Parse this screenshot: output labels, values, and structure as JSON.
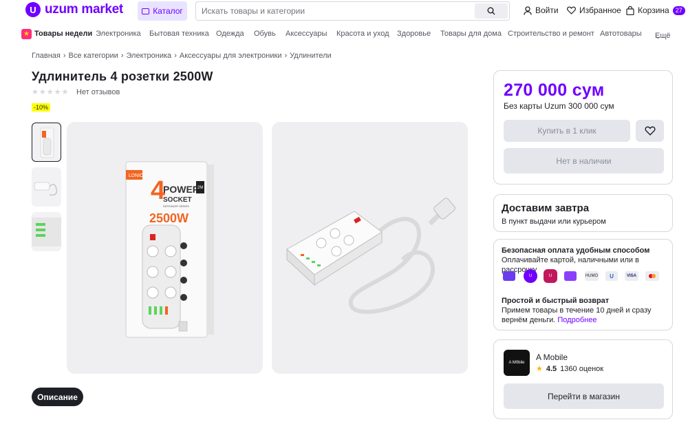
{
  "header": {
    "logo_text": "uzum market",
    "catalog_label": "Каталог",
    "search_placeholder": "Искать товары и категории",
    "login_label": "Войти",
    "favorites_label": "Избранное",
    "cart_label": "Корзина",
    "cart_count": "27",
    "brand_color": "#7000ff"
  },
  "nav": {
    "items": [
      "Товары недели",
      "Электроника",
      "Бытовая техника",
      "Одежда",
      "Обувь",
      "Аксессуары",
      "Красота и уход",
      "Здоровье",
      "Товары для дома",
      "Строительство и ремонт",
      "Автотовары",
      "Ещё"
    ]
  },
  "breadcrumbs": [
    "Главная",
    "Все категории",
    "Электроника",
    "Аксессуары для электроники",
    "Удлинители"
  ],
  "product": {
    "title": "Удлинитель 4 розетки 2500W",
    "rating_count": 0,
    "rating_text": "Нет отзывов",
    "discount_badge": "-10%",
    "box_brand": "LDNIO",
    "box_line1": "4",
    "box_line2": "POWER",
    "box_line3": "SOCKET",
    "box_watt": "2500W",
    "box_series": "DEFENDER SERIES",
    "box_cable": "2M",
    "description_tab": "Описание"
  },
  "buy_box": {
    "price": "270 000 сум",
    "no_card_price": "Без карты Uzum 300 000 сум",
    "buy_one_click": "Купить в 1 клик",
    "out_of_stock": "Нет в наличии"
  },
  "delivery": {
    "title": "Доставим завтра",
    "subtitle": "В пункт выдачи или курьером"
  },
  "payment": {
    "title": "Безопасная оплата удобным способом",
    "subtitle": "Оплачивайте картой, наличными или в рассрочку",
    "methods": [
      {
        "name": "uzcard",
        "label": "",
        "color": "#6a3cf0"
      },
      {
        "name": "uzum-bank",
        "label": "U",
        "color": "#7000ff"
      },
      {
        "name": "uzum-nasiya",
        "label": "U",
        "color": "#c2185b"
      },
      {
        "name": "wallet",
        "label": "",
        "color": "#8a3ffc"
      },
      {
        "name": "humo",
        "label": "HUMO",
        "color": "#e8e8ee"
      },
      {
        "name": "uzcard-u",
        "label": "U",
        "color": "#e8e8ee"
      },
      {
        "name": "visa",
        "label": "VISA",
        "color": "#e8e8ee"
      },
      {
        "name": "mastercard",
        "label": "",
        "color": "#e8e8ee"
      }
    ],
    "return_title": "Простой и быстрый возврат",
    "return_text": "Примем товары в течение 10 дней и сразу вернём деньги.",
    "return_link": "Подробнее"
  },
  "seller": {
    "logo_text": "A M0bile",
    "name": "A Mobile",
    "rating": "4.5",
    "reviews": "1360 оценок",
    "shop_button": "Перейти в магазин"
  }
}
